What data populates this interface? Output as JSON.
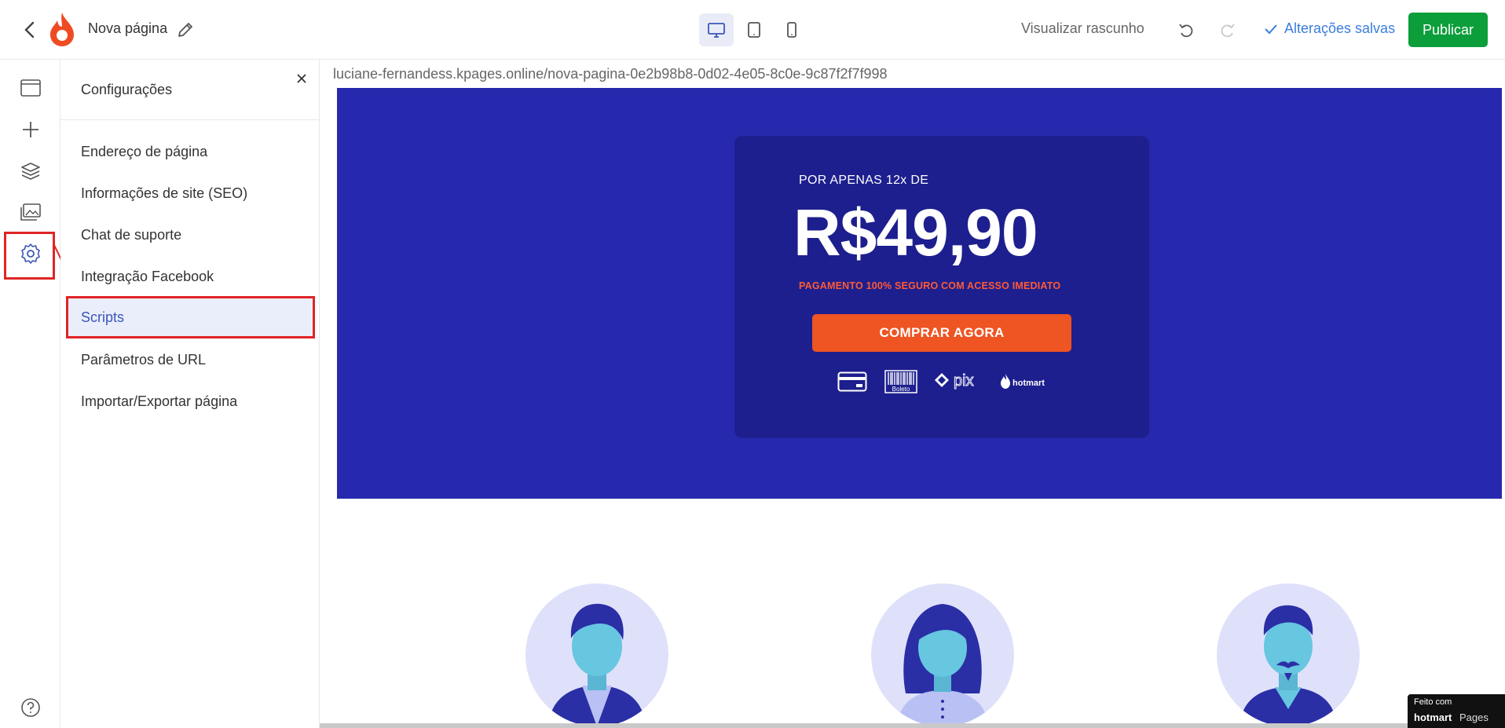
{
  "header": {
    "page_name": "Nova página",
    "preview_label": "Visualizar rascunho",
    "saved_label": "Alterações salvas",
    "publish_label": "Publicar"
  },
  "panel": {
    "title": "Configurações",
    "items": [
      {
        "label": "Endereço de página"
      },
      {
        "label": "Informações de site (SEO)"
      },
      {
        "label": "Chat de suporte"
      },
      {
        "label": "Integração Facebook"
      },
      {
        "label": "Scripts"
      },
      {
        "label": "Parâmetros de URL"
      },
      {
        "label": "Importar/Exportar página"
      }
    ]
  },
  "url": "luciane-fernandess.kpages.online/nova-pagina-0e2b98b8-0d02-4e05-8c0e-9c87f2f7f998",
  "offer": {
    "prefix": "POR APENAS 12x DE",
    "price": "R$49,90",
    "note": "PAGAMENTO 100% SEGURO COM ACESSO IMEDIATO",
    "cta": "COMPRAR AGORA",
    "payment_methods": [
      "credit-card",
      "Boleto",
      "pix",
      "hotmart"
    ]
  },
  "badge": {
    "top": "Feito com",
    "brand": "hotmart",
    "suffix": "Pages"
  },
  "colors": {
    "hero": "#2629ad",
    "card": "#1d1f8e",
    "cta": "#ef5423",
    "publish": "#0b9e3a",
    "highlight": "#e02424"
  }
}
